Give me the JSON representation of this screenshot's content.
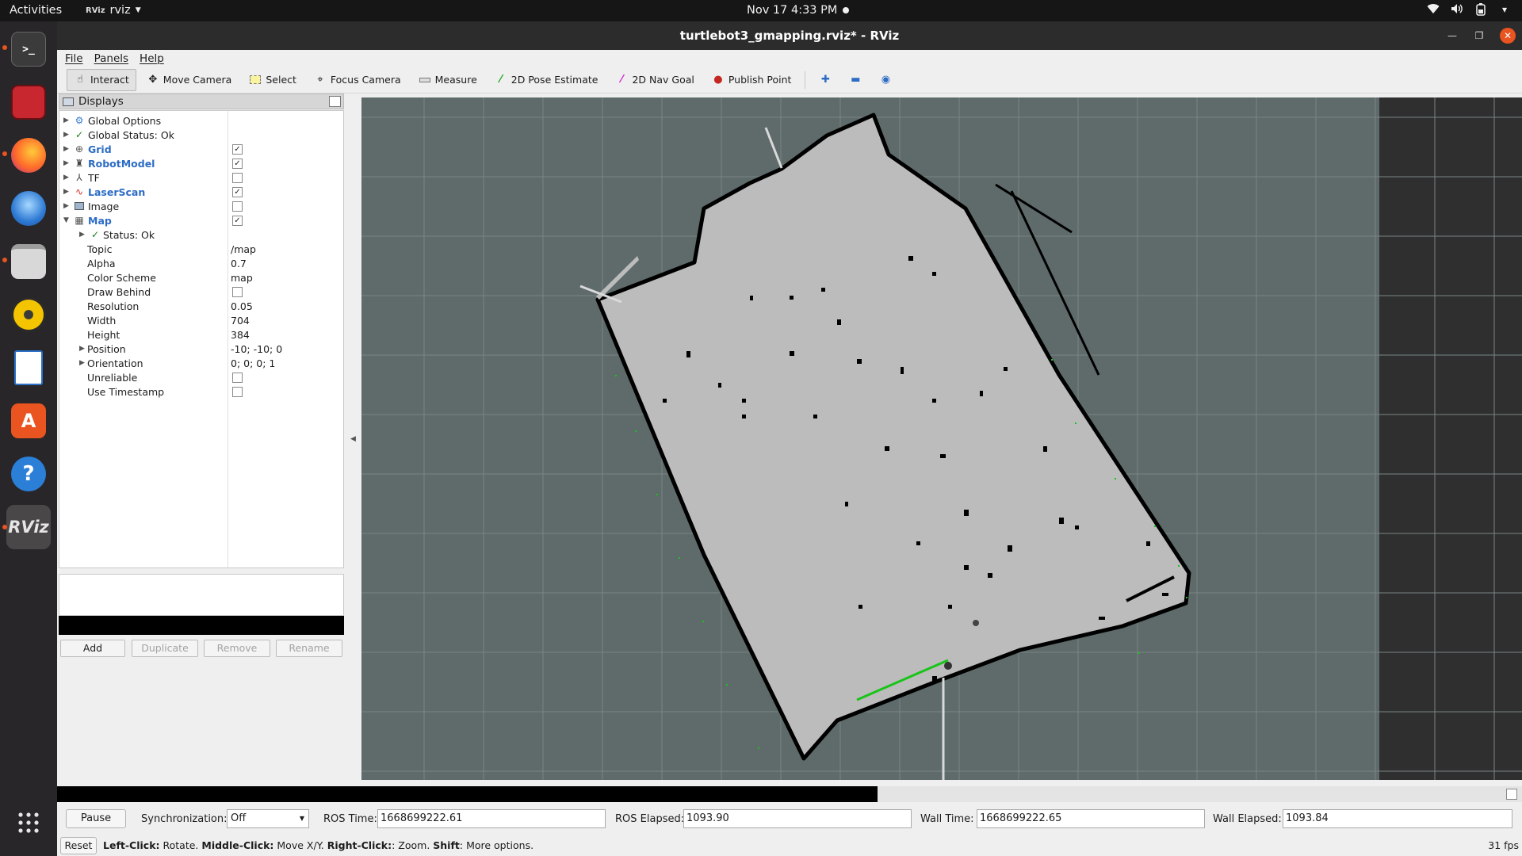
{
  "topbar": {
    "activities": "Activities",
    "app_name": "rviz",
    "app_logo": "R\\iz",
    "datetime": "Nov 17  4:33 PM",
    "tray_icons": [
      "wifi-icon",
      "volume-icon",
      "battery-icon",
      "power-icon"
    ]
  },
  "dock": {
    "items": [
      "terminal",
      "rviz-app",
      "firefox",
      "thunderbird",
      "files",
      "rhythmbox",
      "libreoffice-writer",
      "ubuntu-software",
      "help",
      "rviz",
      "show-apps"
    ],
    "rviz_label": "RViz"
  },
  "window": {
    "title": "turtlebot3_gmapping.rviz* - RViz"
  },
  "menu": [
    "File",
    "Panels",
    "Help"
  ],
  "toolbar": {
    "interact": "Interact",
    "move_camera": "Move Camera",
    "select": "Select",
    "focus_camera": "Focus Camera",
    "measure": "Measure",
    "pose_estimate": "2D Pose Estimate",
    "nav_goal": "2D Nav Goal",
    "publish_point": "Publish Point"
  },
  "displays": {
    "title": "Displays",
    "items": [
      {
        "label": "Global Options"
      },
      {
        "label": "Global Status: Ok"
      },
      {
        "label": "Grid",
        "checked": true
      },
      {
        "label": "RobotModel",
        "checked": true
      },
      {
        "label": "TF",
        "checked": false
      },
      {
        "label": "LaserScan",
        "checked": true
      },
      {
        "label": "Image",
        "checked": false
      },
      {
        "label": "Map",
        "checked": true
      }
    ],
    "map_props": {
      "status": "Status: Ok",
      "topic_label": "Topic",
      "topic": "/map",
      "alpha_label": "Alpha",
      "alpha": "0.7",
      "color_scheme_label": "Color Scheme",
      "color_scheme": "map",
      "draw_behind_label": "Draw Behind",
      "resolution_label": "Resolution",
      "resolution": "0.05",
      "width_label": "Width",
      "width": "704",
      "height_label": "Height",
      "height": "384",
      "position_label": "Position",
      "position": "-10; -10; 0",
      "orientation_label": "Orientation",
      "orientation": "0; 0; 0; 1",
      "unreliable_label": "Unreliable",
      "use_timestamp_label": "Use Timestamp"
    },
    "buttons": {
      "add": "Add",
      "duplicate": "Duplicate",
      "remove": "Remove",
      "rename": "Rename"
    }
  },
  "time": {
    "pause": "Pause",
    "sync_label": "Synchronization:",
    "sync_value": "Off",
    "ros_time_label": "ROS Time:",
    "ros_time": "1668699222.61",
    "ros_elapsed_label": "ROS Elapsed:",
    "ros_elapsed": "1093.90",
    "wall_time_label": "Wall Time:",
    "wall_time": "1668699222.65",
    "wall_elapsed_label": "Wall Elapsed:",
    "wall_elapsed": "1093.84",
    "progress_fraction": 0.56
  },
  "status": {
    "reset": "Reset",
    "hint_b1": "Left-Click:",
    "hint_t1": " Rotate. ",
    "hint_b2": "Middle-Click:",
    "hint_t2": " Move X/Y. ",
    "hint_b3": "Right-Click:",
    "hint_t3": ": Zoom. ",
    "hint_b4": "Shift",
    "hint_t4": ": More options.",
    "fps": "31 fps"
  },
  "colors": {
    "map_free": "#bcbcbc",
    "map_unknown": "#5e6b6a",
    "map_wall": "#000000",
    "laser": "#18c418",
    "link_blue": "#2c6cc4",
    "accent": "#e95420"
  }
}
